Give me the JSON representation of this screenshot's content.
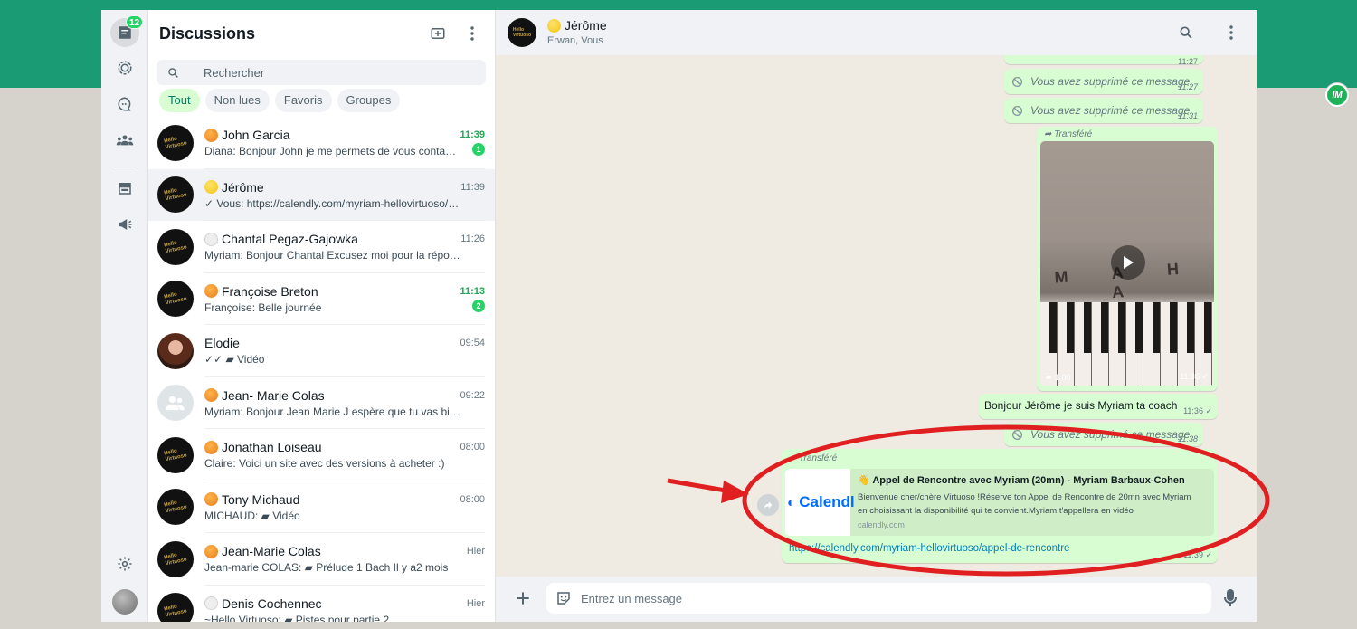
{
  "rail": {
    "chats_badge": "12"
  },
  "list": {
    "title": "Discussions",
    "search_placeholder": "Rechercher",
    "filters": [
      "Tout",
      "Non lues",
      "Favoris",
      "Groupes"
    ],
    "chats": [
      {
        "name": "John Garcia",
        "status": "orange",
        "time": "11:39",
        "unread_time": true,
        "message": "Diana: Bonjour John je me permets de vous contacter par rapport à votre demande",
        "unread": "1",
        "avatar": "logo"
      },
      {
        "name": "Jérôme",
        "status": "yellow",
        "time": "11:39",
        "unread_time": false,
        "message": "✓ Vous: https://calendly.com/myriam-hellovirtuoso/appel-de-rencontre",
        "unread": "",
        "avatar": "logo"
      },
      {
        "name": "Chantal Pegaz-Gajowka",
        "status": "white",
        "time": "11:26",
        "unread_time": false,
        "message": "Myriam: Bonjour Chantal  Excusez moi pour la réponse tardive",
        "unread": "",
        "avatar": "logo"
      },
      {
        "name": "Françoise Breton",
        "status": "orange",
        "time": "11:13",
        "unread_time": true,
        "message": "Françoise: Belle journée",
        "unread": "2",
        "avatar": "logo"
      },
      {
        "name": "Elodie",
        "status": "",
        "time": "09:54",
        "unread_time": false,
        "message": "✓✓ ▰ Vidéo",
        "unread": "",
        "avatar": "photo"
      },
      {
        "name": "Jean- Marie Colas",
        "status": "orange",
        "time": "09:22",
        "unread_time": false,
        "message": "Myriam: Bonjour Jean Marie  J espère que tu vas bien  Je reviens vers toi",
        "unread": "",
        "avatar": "default"
      },
      {
        "name": "Jonathan Loiseau",
        "status": "orange",
        "time": "08:00",
        "unread_time": false,
        "message": "Claire: Voici un site avec des versions à acheter :)",
        "unread": "",
        "avatar": "logo"
      },
      {
        "name": "Tony Michaud",
        "status": "orange",
        "time": "08:00",
        "unread_time": false,
        "message": "MICHAUD: ▰ Vidéo",
        "unread": "",
        "avatar": "logo"
      },
      {
        "name": "Jean-Marie Colas",
        "status": "orange",
        "time": "Hier",
        "unread_time": false,
        "message": "Jean-marie COLAS: ▰ Prélude 1 Bach Il y a2 mois",
        "unread": "",
        "avatar": "logo"
      },
      {
        "name": "Denis Cochennec",
        "status": "white",
        "time": "Hier",
        "unread_time": false,
        "message": "~Hello Virtuoso: ▰ Pistes pour partie 2",
        "unread": "",
        "avatar": "logo"
      }
    ]
  },
  "conversation": {
    "name": "Jérôme",
    "subtitle": "Erwan, Vous",
    "top_time": "11:27",
    "deleted_text": "Vous avez supprimé ce message",
    "deleted_1_time": "11:27",
    "deleted_2_time": "11:31",
    "forwarded_label": "Transféré",
    "video_duration": "1:00",
    "video_time": "11:36 ✓",
    "video_brand": "M A H A",
    "text_message": "Bonjour Jérôme je suis Myriam ta coach",
    "text_time": "11:36 ✓",
    "deleted_3_time": "11:38",
    "link_card": {
      "title": "👋 Appel de Rencontre avec Myriam (20mn) - Myriam Barbaux-Cohen",
      "description": "Bienvenue cher/chère Virtuoso !Réserve ton Appel de Rencontre de 20mn avec Myriam en choisissant la disponibilité qui te convient.Myriam t'appellera en vidéo",
      "domain": "calendly.com",
      "logo_text": "Calendl",
      "url": "https://calendly.com/myriam-hellovirtuoso/appel-de-rencontre",
      "time": "11:39 ✓"
    },
    "composer_placeholder": "Entrez un message"
  },
  "extension_badge": "IM",
  "colors": {
    "brand_green": "#1a9b73",
    "bubble_out": "#d9fdd3",
    "annotation_red": "#e02020"
  }
}
